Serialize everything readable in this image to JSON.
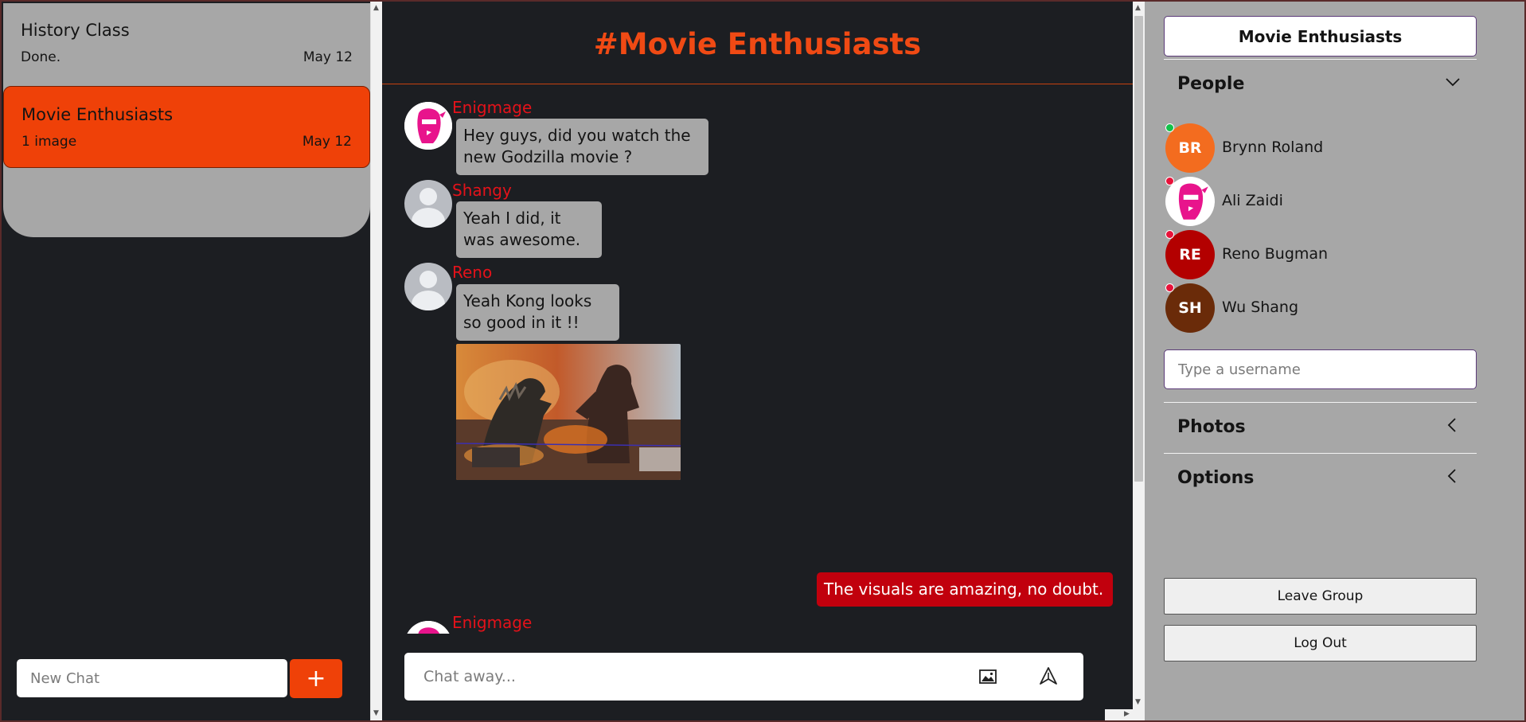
{
  "sidebar": {
    "chats": [
      {
        "title": "History Class",
        "preview": "Done.",
        "date": "May 12"
      },
      {
        "title": "Movie Enthusiasts",
        "preview": "1 image",
        "date": "May 12"
      }
    ],
    "new_chat_placeholder": "New Chat",
    "add_label": "+"
  },
  "channel": {
    "title": "#Movie Enthusiasts",
    "messages": [
      {
        "author": "Enigmage",
        "text_lines": [
          "Hey guys, did you watch the",
          "new Godzilla movie ?"
        ]
      },
      {
        "author": "Shangy",
        "text_lines": [
          "Yeah I did, it",
          "was awesome."
        ]
      },
      {
        "author": "Reno",
        "text_lines": [
          "Yeah Kong looks",
          "so good in it !!"
        ]
      },
      {
        "author": "me",
        "text": "The visuals are amazing, no doubt."
      },
      {
        "author": "Enigmage"
      }
    ],
    "chat_placeholder": "Chat away..."
  },
  "details": {
    "group_name": "Movie Enthusiasts",
    "people_label": "People",
    "people": [
      {
        "initials": "BR",
        "name": "Brynn Roland",
        "color": "#f36c1f",
        "status": "online",
        "status_color": "#12c24a"
      },
      {
        "initials": "",
        "name": "Ali Zaidi",
        "color": "#ffffff",
        "status": "offline",
        "status_color": "#e8123a"
      },
      {
        "initials": "RE",
        "name": "Reno Bugman",
        "color": "#b30000",
        "status": "offline",
        "status_color": "#e8123a"
      },
      {
        "initials": "SH",
        "name": "Wu Shang",
        "color": "#6a2b09",
        "status": "offline",
        "status_color": "#e8123a"
      }
    ],
    "username_placeholder": "Type a username",
    "photos_label": "Photos",
    "options_label": "Options",
    "leave_label": "Leave Group",
    "logout_label": "Log Out"
  },
  "colors": {
    "accent": "#ef4108",
    "title": "#f04a14",
    "author": "#e4121a",
    "my_bubble": "#c1000d",
    "panel_gray": "#a7a7a7",
    "background": "#1c1e22"
  }
}
